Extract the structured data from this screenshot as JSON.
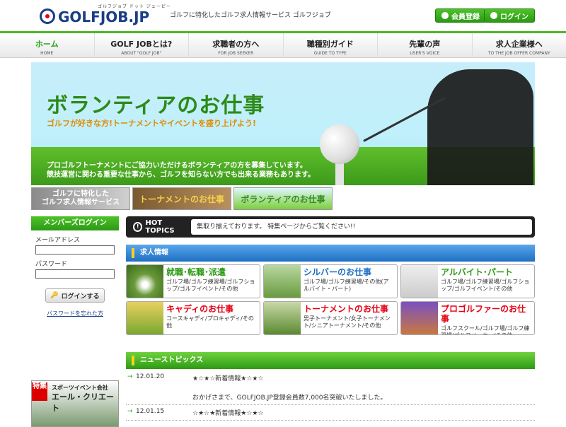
{
  "header": {
    "logo_ruby": "ゴルフジョブ ドット ジェーピー",
    "logo_text": "GOLFJOB.JP",
    "tagline": "ゴルフに特化したゴルフ求人情報サービス ゴルフジョブ",
    "register_label": "会員登録",
    "login_label": "ログイン"
  },
  "nav": [
    {
      "ja": "ホーム",
      "en": "HOME"
    },
    {
      "ja": "GOLF JOBとは?",
      "en": "ABOUT \"GOLF JOB\""
    },
    {
      "ja": "求職者の方へ",
      "en": "FOR JOB SEEKER"
    },
    {
      "ja": "職種別ガイド",
      "en": "GUIDE TO TYPE"
    },
    {
      "ja": "先輩の声",
      "en": "USER'S VOICE"
    },
    {
      "ja": "求人企業様へ",
      "en": "TO THE JOB OFFER COMPANY"
    }
  ],
  "hero": {
    "title": "ボランティアのお仕事",
    "subtitle": "ゴルフが好きな方!トーナメントやイベントを盛り上げよう!",
    "desc1": "プロゴルフトーナメントにご協力いただけるボランティアの方を募集しています。",
    "desc2": "競技運営に関わる重要な仕事から、ゴルフを知らない方でも出来る業務もあります。"
  },
  "thumbs": {
    "t1a": "ゴルフに特化した",
    "t1b": "ゴルフ求人情報サービス",
    "t2": "トーナメントのお仕事",
    "t3": "ボランティアのお仕事"
  },
  "sidebar": {
    "heading": "メンバーズログイン",
    "email_label": "メールアドレス",
    "password_label": "パスワード",
    "login_button": "ログインする",
    "forgot_link": "パスワードを忘れた方",
    "ad_badge": "特集",
    "ad_line1": "スポーツイベント会社",
    "ad_line2": "エール・クリエート"
  },
  "topics": {
    "label": "HOT TOPICS",
    "text": "集取り揃えております。 特集ページからご覧ください!!"
  },
  "jobs_heading": "求人情報",
  "jobs": [
    {
      "title": "就職･転職･派遣",
      "desc": "ゴルフ場/ゴルフ練習場/ゴルフショップ/ゴルフイベント/その他",
      "color": "#2d9a15"
    },
    {
      "title": "シルバーのお仕事",
      "desc": "ゴルフ場/ゴルフ練習場/その他(アルバイト・パート)",
      "color": "#1e6fc4"
    },
    {
      "title": "アルバイト･パート",
      "desc": "ゴルフ場/ゴルフ練習場/ゴルフショップ/ゴルフイベント/その他",
      "color": "#2d9a15"
    },
    {
      "title": "キャディのお仕事",
      "desc": "コースキャディ/プロキャディ/その他",
      "color": "#e60012"
    },
    {
      "title": "トーナメントのお仕事",
      "desc": "男子トーナメント/女子トーナメント/シニアトーナメント/その他",
      "color": "#e60012"
    },
    {
      "title": "プロゴルファーのお仕事",
      "desc": "ゴルフスクール/ゴルフ場/ゴルフ練習場/ゴルフメーカー/その他",
      "color": "#e60012"
    }
  ],
  "news_heading": "ニューストピックス",
  "news": [
    {
      "date": "12.01.20",
      "title": "★☆★☆新着情報★☆★☆",
      "body": "おかげさまで、GOLFJOB.JP登録会員数7,000名突破いたしました。"
    },
    {
      "date": "12.01.15",
      "title": "☆★☆★新着情報★☆★☆",
      "body": ""
    }
  ]
}
